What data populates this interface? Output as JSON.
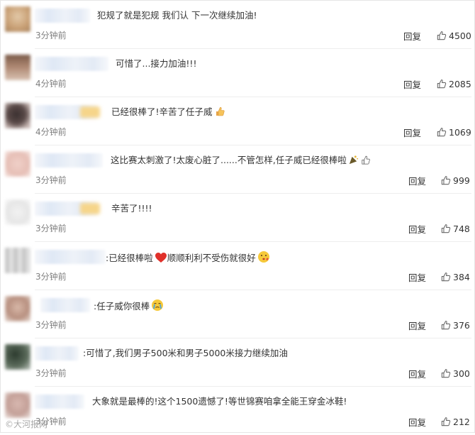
{
  "comments": [
    {
      "text": "犯规了就是犯规 我们认 下一次继续加油!",
      "time": "3分钟前",
      "reply": "回复",
      "likes": "4500"
    },
    {
      "text": "可惜了...接力加油!!!",
      "time": "4分钟前",
      "reply": "回复",
      "likes": "2085"
    },
    {
      "text": "已经很棒了!辛苦了任子威",
      "time": "4分钟前",
      "reply": "回复",
      "likes": "1069"
    },
    {
      "text": "这比赛太刺激了!太废心脏了......不管怎样,任子威已经很棒啦",
      "time": "3分钟前",
      "reply": "回复",
      "likes": "999"
    },
    {
      "text": "辛苦了!!!!",
      "time": "3分钟前",
      "reply": "回复",
      "likes": "748"
    },
    {
      "text_a": ":已经很棒啦",
      "text_b": "顺顺利利不受伤就很好",
      "time": "3分钟前",
      "reply": "回复",
      "likes": "384"
    },
    {
      "text": ":任子威你很棒",
      "time": "3分钟前",
      "reply": "回复",
      "likes": "376"
    },
    {
      "text": ":可惜了,我们男子500米和男子5000米接力继续加油",
      "time": "3分钟前",
      "reply": "回复",
      "likes": "300"
    },
    {
      "text": "大象就是最棒的!这个1500遗憾了!等世锦赛咱拿全能王穿金冰鞋!",
      "time": "3分钟前",
      "reply": "回复",
      "likes": "212"
    }
  ],
  "watermark": "©大河报网",
  "colors": {
    "text": "#333333",
    "muted": "#808080",
    "separator": "#ededed"
  }
}
